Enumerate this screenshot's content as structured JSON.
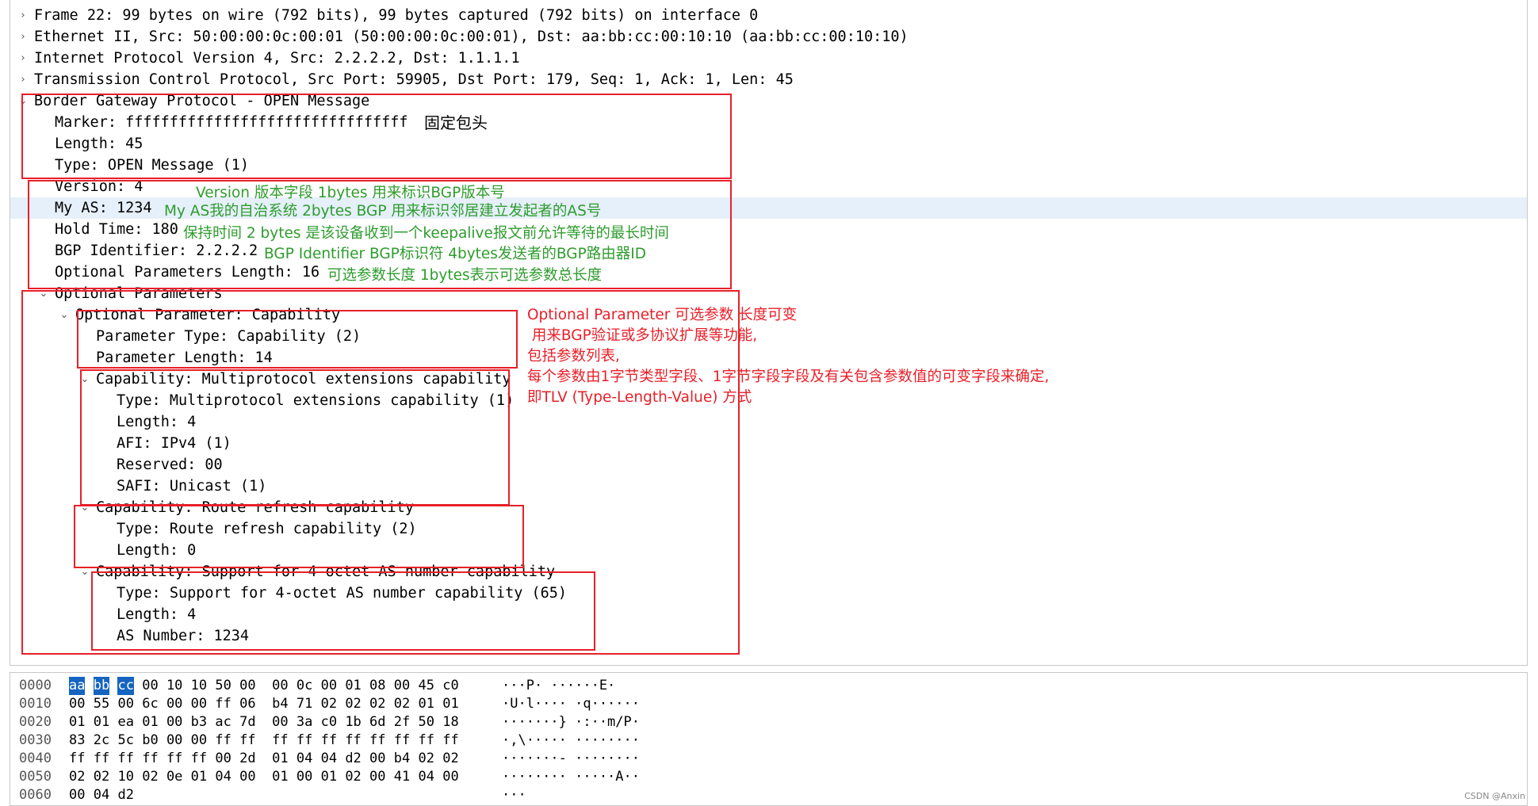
{
  "detail": {
    "rows": [
      {
        "text": "Frame 22: 99 bytes on wire (792 bits), 99 bytes captured (792 bits) on interface 0",
        "arrow": "›",
        "indent": 0
      },
      {
        "text": "Ethernet II, Src: 50:00:00:0c:00:01 (50:00:00:0c:00:01), Dst: aa:bb:cc:00:10:10 (aa:bb:cc:00:10:10)",
        "arrow": "›",
        "indent": 0
      },
      {
        "text": "Internet Protocol Version 4, Src: 2.2.2.2, Dst: 1.1.1.1",
        "arrow": "›",
        "indent": 0
      },
      {
        "text": "Transmission Control Protocol, Src Port: 59905, Dst Port: 179, Seq: 1, Ack: 1, Len: 45",
        "arrow": "›",
        "indent": 0
      },
      {
        "text": "Border Gateway Protocol - OPEN Message",
        "arrow": "⌄",
        "indent": 0
      },
      {
        "text": "Marker: ffffffffffffffffffffffffffffffff",
        "arrow": "",
        "indent": 1
      },
      {
        "text": "Length: 45",
        "arrow": "",
        "indent": 1
      },
      {
        "text": "Type: OPEN Message (1)",
        "arrow": "",
        "indent": 1
      },
      {
        "text": "Version: 4",
        "arrow": "",
        "indent": 1
      },
      {
        "text": "My AS: 1234",
        "arrow": "",
        "indent": 1,
        "selected": true
      },
      {
        "text": "Hold Time: 180",
        "arrow": "",
        "indent": 1
      },
      {
        "text": "BGP Identifier: 2.2.2.2",
        "arrow": "",
        "indent": 1
      },
      {
        "text": "Optional Parameters Length: 16",
        "arrow": "",
        "indent": 1
      },
      {
        "text": "Optional Parameters",
        "arrow": "⌄",
        "indent": 1
      },
      {
        "text": "Optional Parameter: Capability",
        "arrow": "⌄",
        "indent": 2
      },
      {
        "text": "Parameter Type: Capability (2)",
        "arrow": "",
        "indent": 3
      },
      {
        "text": "Parameter Length: 14",
        "arrow": "",
        "indent": 3
      },
      {
        "text": "Capability: Multiprotocol extensions capability",
        "arrow": "⌄",
        "indent": 3
      },
      {
        "text": "Type: Multiprotocol extensions capability (1)",
        "arrow": "",
        "indent": 4
      },
      {
        "text": "Length: 4",
        "arrow": "",
        "indent": 4
      },
      {
        "text": "AFI: IPv4 (1)",
        "arrow": "",
        "indent": 4
      },
      {
        "text": "Reserved: 00",
        "arrow": "",
        "indent": 4
      },
      {
        "text": "SAFI: Unicast (1)",
        "arrow": "",
        "indent": 4
      },
      {
        "text": "Capability: Route refresh capability",
        "arrow": "⌄",
        "indent": 3
      },
      {
        "text": "Type: Route refresh capability (2)",
        "arrow": "",
        "indent": 4
      },
      {
        "text": "Length: 0",
        "arrow": "",
        "indent": 4
      },
      {
        "text": "Capability: Support for 4-octet AS number capability",
        "arrow": "⌄",
        "indent": 3
      },
      {
        "text": "Type: Support for 4-octet AS number capability (65)",
        "arrow": "",
        "indent": 4
      },
      {
        "text": "Length: 4",
        "arrow": "",
        "indent": 4
      },
      {
        "text": "AS Number: 1234",
        "arrow": "",
        "indent": 4
      }
    ]
  },
  "annotations": {
    "header_note": "固定包头",
    "version_note": "Version 版本字段 1bytes 用来标识BGP版本号",
    "my_as_note": "My AS我的自治系统 2bytes BGP 用来标识邻居建立发起者的AS号",
    "hold_time_note": "保持时间 2 bytes 是该设备收到一个keepalive报文前允许等待的最长时间",
    "bgp_id_note": "BGP Identifier BGP标识符 4bytes发送者的BGP路由器ID",
    "opt_len_note": "可选参数长度 1bytes表示可选参数总长度",
    "opt_param_note": [
      "Optional Parameter 可选参数 长度可变",
      " 用来BGP验证或多协议扩展等功能,",
      "包括参数列表,",
      "每个参数由1字节类型字段、1字节字段字段及有关包含参数值的可变字段来确定,",
      "即TLV (Type-Length-Value) 方式"
    ]
  },
  "hex": {
    "rows": [
      {
        "offset": "0000",
        "bytes": [
          "aa",
          "bb",
          "cc",
          "00",
          "10",
          "10",
          "50",
          "00",
          "00",
          "0c",
          "00",
          "01",
          "08",
          "00",
          "45",
          "c0"
        ],
        "ascii": "···P· ······E·",
        "highlight": [
          0,
          1,
          2
        ]
      },
      {
        "offset": "0010",
        "bytes": [
          "00",
          "55",
          "00",
          "6c",
          "00",
          "00",
          "ff",
          "06",
          "b4",
          "71",
          "02",
          "02",
          "02",
          "02",
          "01",
          "01"
        ],
        "ascii": "·U·l···· ·q······",
        "highlight": []
      },
      {
        "offset": "0020",
        "bytes": [
          "01",
          "01",
          "ea",
          "01",
          "00",
          "b3",
          "ac",
          "7d",
          "00",
          "3a",
          "c0",
          "1b",
          "6d",
          "2f",
          "50",
          "18"
        ],
        "ascii": "·······} ·:··m/P·",
        "highlight": []
      },
      {
        "offset": "0030",
        "bytes": [
          "83",
          "2c",
          "5c",
          "b0",
          "00",
          "00",
          "ff",
          "ff",
          "ff",
          "ff",
          "ff",
          "ff",
          "ff",
          "ff",
          "ff",
          "ff"
        ],
        "ascii": "·,\\····· ········",
        "highlight": []
      },
      {
        "offset": "0040",
        "bytes": [
          "ff",
          "ff",
          "ff",
          "ff",
          "ff",
          "ff",
          "00",
          "2d",
          "01",
          "04",
          "04",
          "d2",
          "00",
          "b4",
          "02",
          "02"
        ],
        "ascii": "·······- ········",
        "highlight": []
      },
      {
        "offset": "0050",
        "bytes": [
          "02",
          "02",
          "10",
          "02",
          "0e",
          "01",
          "04",
          "00",
          "01",
          "00",
          "01",
          "02",
          "00",
          "41",
          "04",
          "00"
        ],
        "ascii": "········ ·····A··",
        "highlight": []
      },
      {
        "offset": "0060",
        "bytes": [
          "00",
          "04",
          "d2"
        ],
        "ascii": "···",
        "highlight": []
      }
    ]
  },
  "watermark": "CSDN @Anxin"
}
